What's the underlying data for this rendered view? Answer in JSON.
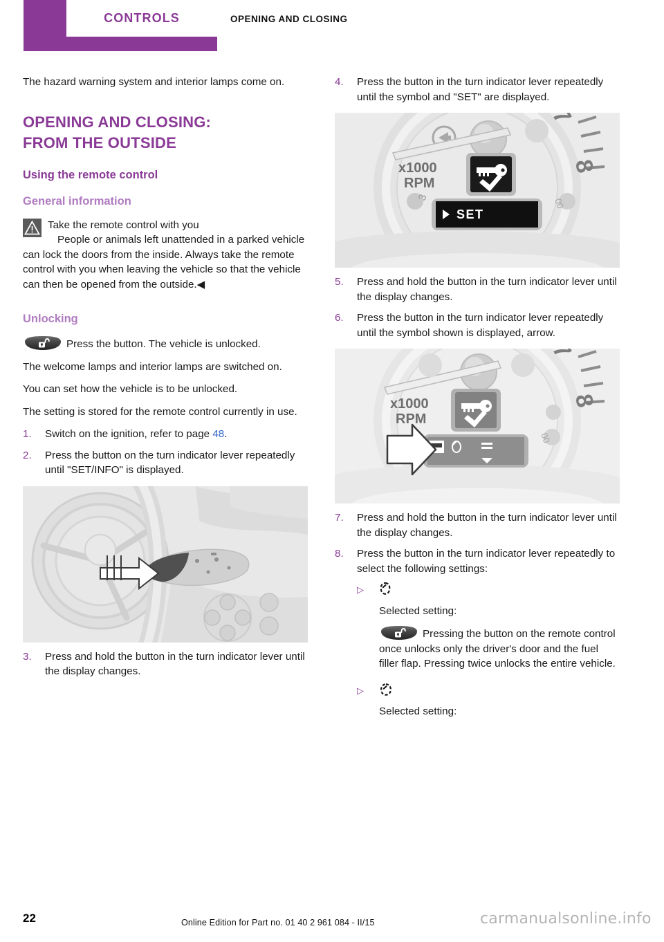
{
  "header": {
    "tab_label": "CONTROLS",
    "chapter": "OPENING AND CLOSING"
  },
  "colors": {
    "accent": "#8a3a96",
    "accent_light": "#b07cc0",
    "link": "#3366cc",
    "watermark": "#b4b4b4"
  },
  "left_column": {
    "intro": "The hazard warning system and interior lamps come on.",
    "section_title": "OPENING AND CLOSING: FROM THE OUTSIDE",
    "subsection_title": "Using the remote control",
    "general_info_title": "General information",
    "warning": {
      "icon": "warning-triangle-icon",
      "heading": "Take the remote control with you",
      "body": "People or animals left unattended in a parked vehicle can lock the doors from the inside. Always take the remote control with you when leaving the vehicle so that the vehicle can then be opened from the outside.",
      "end_marker": "◀"
    },
    "unlocking_title": "Unlocking",
    "unlocking_icon": "remote-unlock-button-icon",
    "unlocking_lead": "Press the button. The vehicle is unlocked.",
    "paragraphs": [
      "The welcome lamps and interior lamps are switched on.",
      "You can set how the vehicle is to be unlocked.",
      "The setting is stored for the remote control currently in use."
    ],
    "steps": [
      {
        "num": "1.",
        "text": "Switch on the ignition, refer to page ",
        "link": "48",
        "after": "."
      },
      {
        "num": "2.",
        "text": "Press the button on the turn indicator lever repeatedly until \"SET/INFO\" is displayed."
      }
    ],
    "figure_caption": "steering-wheel-turn-indicator-lever",
    "step3": {
      "num": "3.",
      "text": "Press and hold the button in the turn indicator lever until the display changes."
    }
  },
  "right_column": {
    "step4": {
      "num": "4.",
      "text": "Press the button in the turn indicator lever repeatedly until the symbol and \"SET\" are displayed."
    },
    "figure1": {
      "name": "tachometer-display-set",
      "scale_label_line1": "x1000",
      "scale_label_line2": "RPM",
      "tick_8": "8",
      "display_text": "SET",
      "display_symbol": "key-check-icon"
    },
    "step5": {
      "num": "5.",
      "text": "Press and hold the button in the turn indicator lever until the display changes."
    },
    "step6": {
      "num": "6.",
      "text": "Press the button in the turn indicator lever repeatedly until the symbol shown is displayed, arrow."
    },
    "figure2": {
      "name": "tachometer-display-door-symbol",
      "scale_label_line1": "x1000",
      "scale_label_line2": "RPM",
      "tick_8": "8",
      "display_symbol": "key-check-icon",
      "menu_icons": [
        "car-door-icon",
        "lock-cylinder-icon",
        "window-icon",
        "chevron-down-icon"
      ],
      "callout": "white-arrow-icon"
    },
    "step7": {
      "num": "7.",
      "text": "Press and hold the button in the turn indicator lever until the display changes."
    },
    "step8": {
      "num": "8.",
      "text": "Press the button in the turn indicator lever repeatedly to select the following settings:"
    },
    "bullets": [
      {
        "marker": "▷",
        "symbol": "lock-cylinder-icon",
        "label": "Selected setting:",
        "detail_icon": "remote-unlock-button-icon",
        "detail": "Pressing the button on the remote control once unlocks only the driver's door and the fuel filler flap. Pressing twice unlocks the entire vehicle."
      },
      {
        "marker": "▷",
        "symbol": "vehicle-unlock-all-icon",
        "label": "Selected setting:"
      }
    ]
  },
  "footer": {
    "page_number": "22",
    "edition": "Online Edition for Part no. 01 40 2 961 084 - II/15",
    "watermark": "carmanualsonline.info"
  }
}
